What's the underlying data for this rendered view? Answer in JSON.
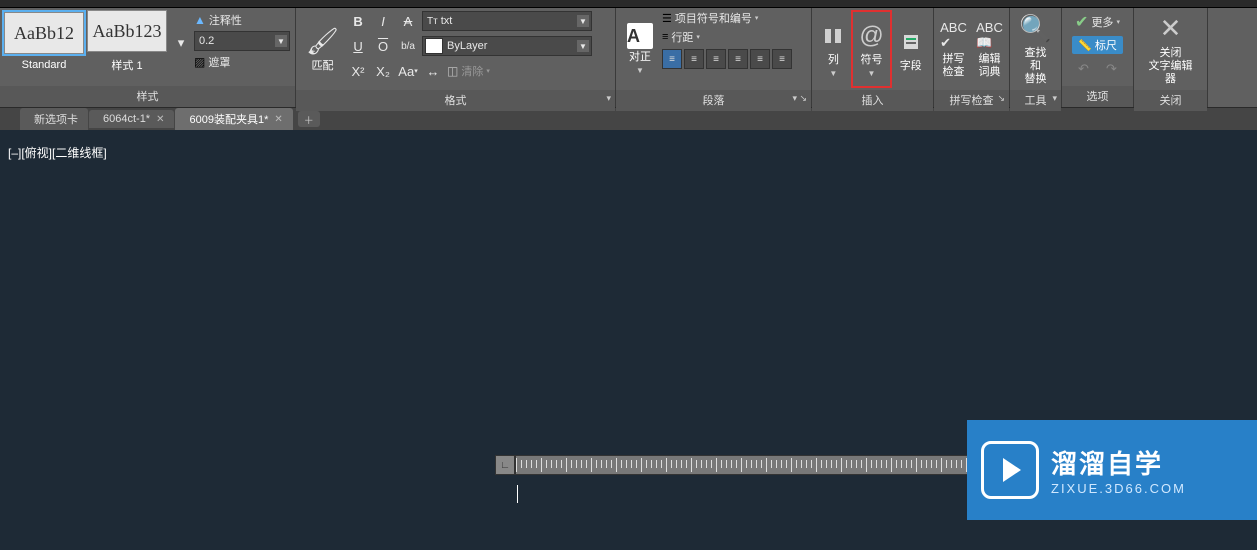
{
  "styles_panel": {
    "title": "样式",
    "style_a_preview": "AaBb12",
    "style_a_name": "Standard",
    "style_b_preview": "AaBb123",
    "style_b_name": "样式 1",
    "annotative_label": "注释性",
    "height_value": "0.2",
    "mask_label": "遮罩"
  },
  "format_panel": {
    "title": "格式",
    "match_label": "匹配",
    "font_value": "txt",
    "layer_value": "ByLayer",
    "clear_label": "清除"
  },
  "paragraph_panel": {
    "title": "段落",
    "justify_label": "对正",
    "bullets_label": "项目符号和编号",
    "linespacing_label": "行距"
  },
  "insert_panel": {
    "title": "插入",
    "columns_label": "列",
    "symbol_label": "符号",
    "field_label": "字段"
  },
  "spell_panel": {
    "title": "拼写检查",
    "spell_label": "拼写\n检查",
    "dict_label": "编辑\n词典"
  },
  "tools_panel": {
    "title": "工具",
    "find_label": "查找和\n替换"
  },
  "options_panel": {
    "title": "选项",
    "more_label": "更多",
    "ruler_label": "标尺"
  },
  "close_panel": {
    "title": "关闭",
    "close_label": "关闭\n文字编辑器"
  },
  "tabs": {
    "t1": "新选项卡",
    "t2": "6064ct-1*",
    "t3": "6009装配夹具1*"
  },
  "viewport_label": "[–][俯视][二维线框]",
  "watermark": {
    "title": "溜溜自学",
    "sub": "ZIXUE.3D66.COM"
  }
}
